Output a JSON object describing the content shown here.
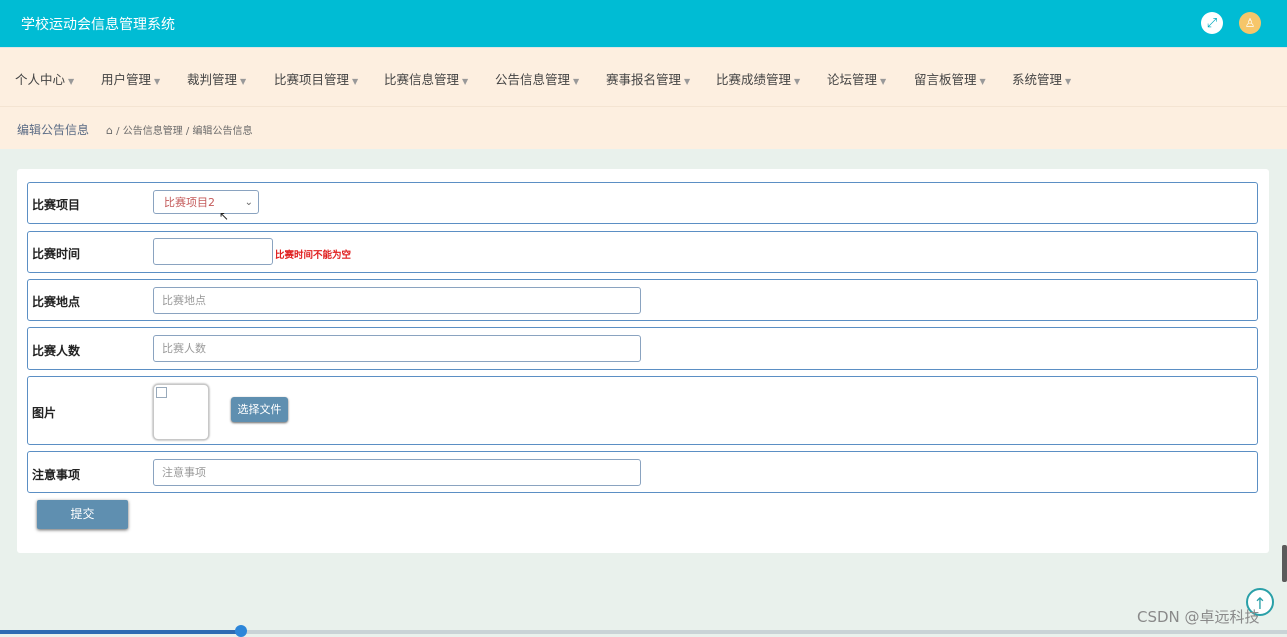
{
  "header": {
    "title": "学校运动会信息管理系统",
    "fullscreen_icon": "expand-icon",
    "avatar_icon": "user-icon"
  },
  "nav": {
    "items": [
      {
        "label": "个人中心"
      },
      {
        "label": "用户管理"
      },
      {
        "label": "裁判管理"
      },
      {
        "label": "比赛项目管理"
      },
      {
        "label": "比赛信息管理"
      },
      {
        "label": "公告信息管理"
      },
      {
        "label": "赛事报名管理"
      },
      {
        "label": "比赛成绩管理"
      },
      {
        "label": "论坛管理"
      },
      {
        "label": "留言板管理"
      },
      {
        "label": "系统管理"
      }
    ]
  },
  "breadcrumb": {
    "page_title": "编辑公告信息",
    "trail": [
      "公告信息管理",
      "编辑公告信息"
    ]
  },
  "form": {
    "project": {
      "label": "比赛项目",
      "value": "比赛项目2"
    },
    "time": {
      "label": "比赛时间",
      "value": "",
      "error": "比赛时间不能为空"
    },
    "location": {
      "label": "比赛地点",
      "placeholder": "比赛地点"
    },
    "count": {
      "label": "比赛人数",
      "placeholder": "比赛人数"
    },
    "image": {
      "label": "图片",
      "button": "选择文件"
    },
    "notes": {
      "label": "注意事项",
      "placeholder": "注意事项"
    },
    "submit": "提交"
  },
  "watermark": "CSDN @卓远科技",
  "colors": {
    "header": "#00bcd4",
    "nav_bg": "#fdefe0",
    "button": "#5f8fb0",
    "error": "#e01f1f",
    "field_border": "#5b8fc4"
  }
}
